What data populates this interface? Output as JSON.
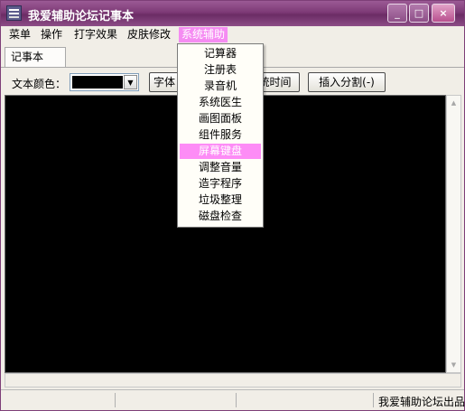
{
  "window": {
    "title": "我爱辅助论坛记事本",
    "min_icon": "minimize-icon",
    "max_icon": "maximize-icon",
    "close_icon": "close-icon",
    "close_glyph": "×"
  },
  "menubar": {
    "items": [
      "菜单",
      "操作",
      "打字效果",
      "皮肤修改",
      "系统辅助"
    ],
    "active": "系统辅助",
    "active_color": "#f58cf2"
  },
  "tabs": {
    "items": [
      "记事本"
    ]
  },
  "toolbar": {
    "color_label": "文本颜色：",
    "color_value": "#000000",
    "font_button": "字体",
    "time_button": "统时间",
    "split_button": "插入分割(-)"
  },
  "dropdown": {
    "items": [
      "记算器",
      "注册表",
      "录音机",
      "系统医生",
      "画图面板",
      "组件服务",
      "屏幕键盘",
      "调整音量",
      "造字程序",
      "垃圾整理",
      "磁盘检查"
    ],
    "highlighted": "屏幕键盘",
    "highlight_color": "#fd8cf6"
  },
  "editor": {
    "background": "#000000",
    "value": ""
  },
  "statusbar": {
    "text": "我爱辅助论坛出品"
  }
}
